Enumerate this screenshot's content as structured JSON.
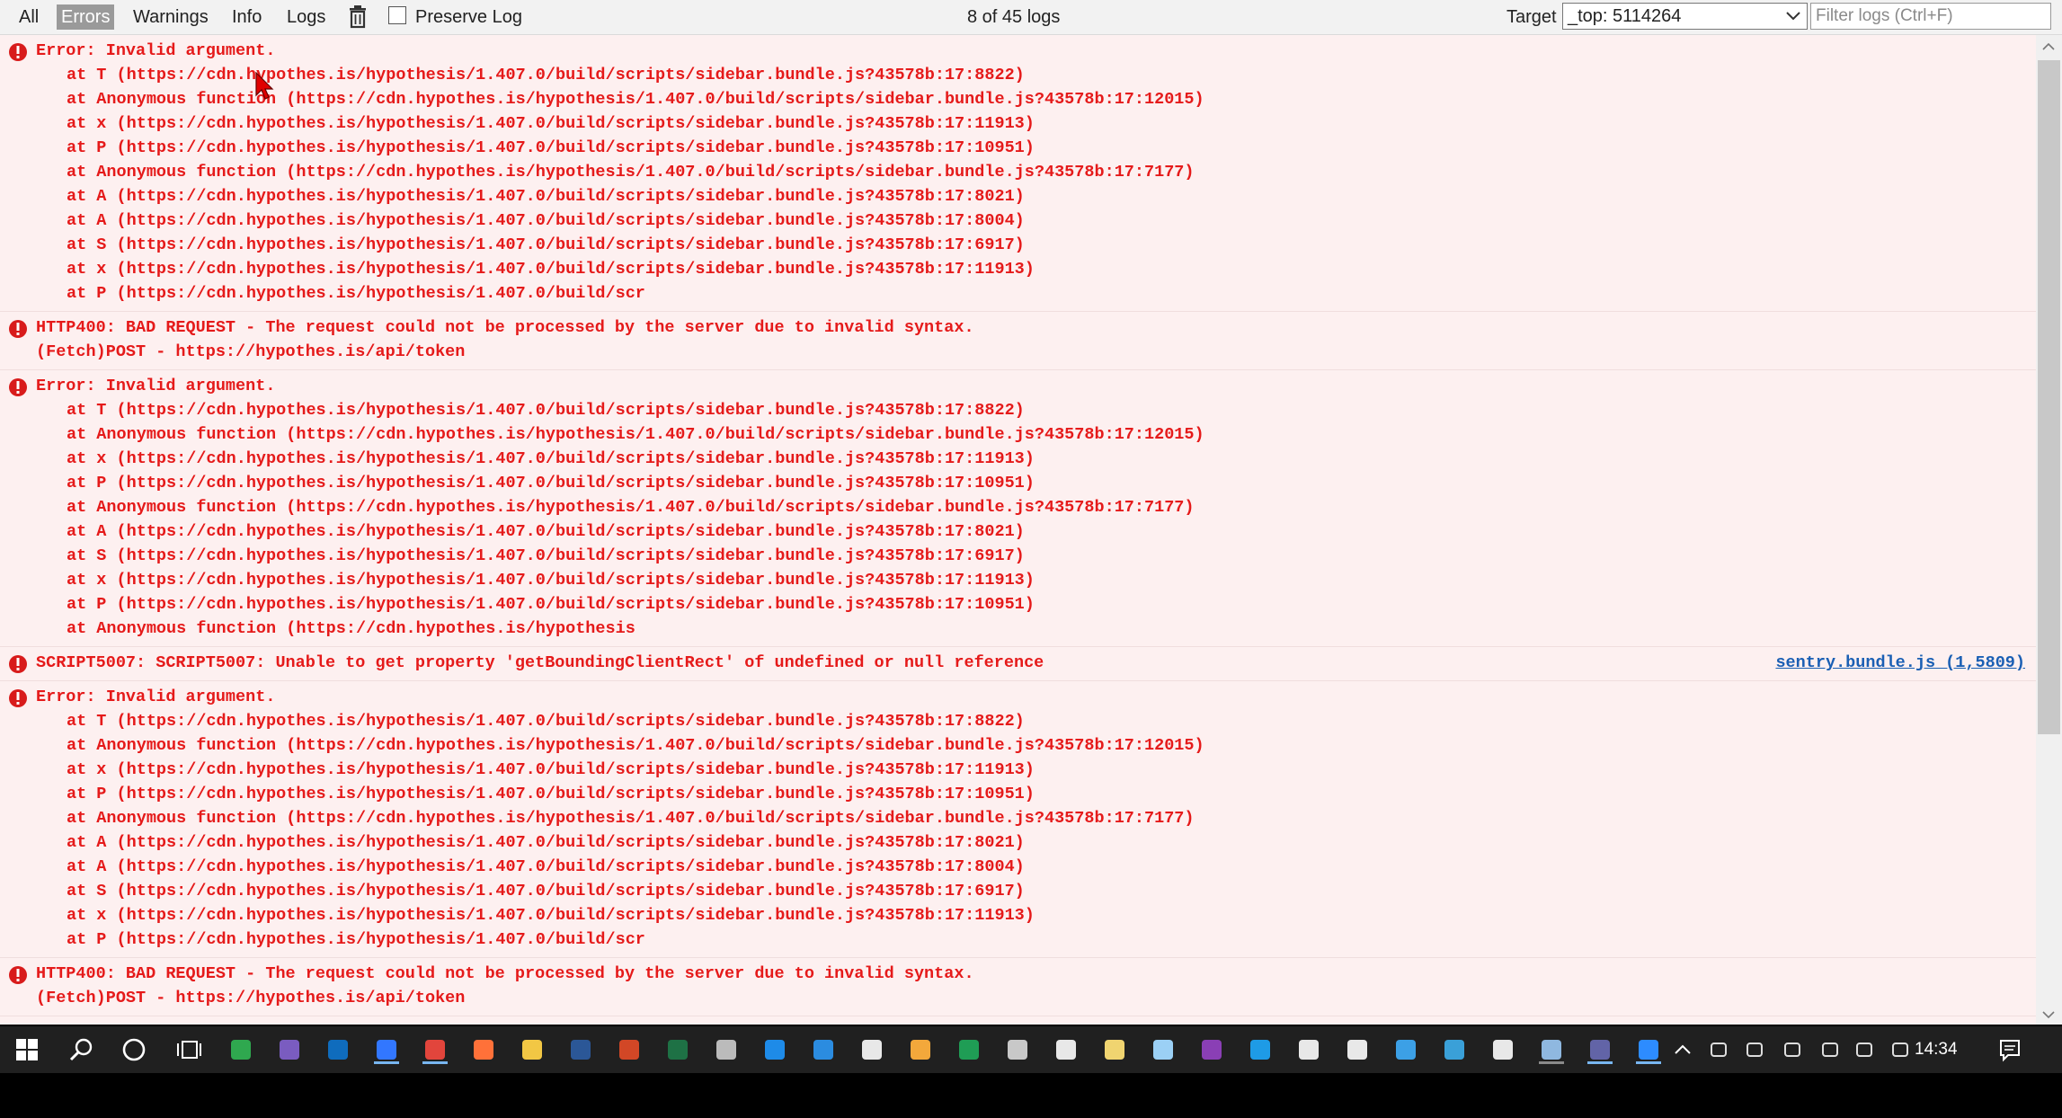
{
  "toolbar": {
    "filters": [
      {
        "label": "All",
        "active": false
      },
      {
        "label": "Errors",
        "active": true
      },
      {
        "label": "Warnings",
        "active": false
      },
      {
        "label": "Info",
        "active": false
      },
      {
        "label": "Logs",
        "active": false
      }
    ],
    "clear_icon": "trash-icon",
    "preserve_log_label": "Preserve Log",
    "preserve_log_checked": false,
    "log_count": "8 of 45 logs",
    "target_label": "Target",
    "target_value": "_top: 5114264",
    "filter_placeholder": "Filter logs (Ctrl+F)",
    "filter_value": ""
  },
  "colors": {
    "error_text": "#e51a1a",
    "error_bg": "#fdf0f0",
    "link": "#1a5fb4",
    "active_filter": "#9a9a9a"
  },
  "logs": [
    {
      "message": "Error: Invalid argument.",
      "frames": [
        "at T (https://cdn.hypothes.is/hypothesis/1.407.0/build/scripts/sidebar.bundle.js?43578b:17:8822)",
        "at Anonymous function (https://cdn.hypothes.is/hypothesis/1.407.0/build/scripts/sidebar.bundle.js?43578b:17:12015)",
        "at x (https://cdn.hypothes.is/hypothesis/1.407.0/build/scripts/sidebar.bundle.js?43578b:17:11913)",
        "at P (https://cdn.hypothes.is/hypothesis/1.407.0/build/scripts/sidebar.bundle.js?43578b:17:10951)",
        "at Anonymous function (https://cdn.hypothes.is/hypothesis/1.407.0/build/scripts/sidebar.bundle.js?43578b:17:7177)",
        "at A (https://cdn.hypothes.is/hypothesis/1.407.0/build/scripts/sidebar.bundle.js?43578b:17:8021)",
        "at A (https://cdn.hypothes.is/hypothesis/1.407.0/build/scripts/sidebar.bundle.js?43578b:17:8004)",
        "at S (https://cdn.hypothes.is/hypothesis/1.407.0/build/scripts/sidebar.bundle.js?43578b:17:6917)",
        "at x (https://cdn.hypothes.is/hypothesis/1.407.0/build/scripts/sidebar.bundle.js?43578b:17:11913)",
        "at P (https://cdn.hypothes.is/hypothesis/1.407.0/build/scr"
      ],
      "source": ""
    },
    {
      "message": "HTTP400: BAD REQUEST - The request could not be processed by the server due to invalid syntax.",
      "frames": [],
      "detail": "(Fetch)POST - https://hypothes.is/api/token",
      "source": ""
    },
    {
      "message": "Error: Invalid argument.",
      "frames": [
        "at T (https://cdn.hypothes.is/hypothesis/1.407.0/build/scripts/sidebar.bundle.js?43578b:17:8822)",
        "at Anonymous function (https://cdn.hypothes.is/hypothesis/1.407.0/build/scripts/sidebar.bundle.js?43578b:17:12015)",
        "at x (https://cdn.hypothes.is/hypothesis/1.407.0/build/scripts/sidebar.bundle.js?43578b:17:11913)",
        "at P (https://cdn.hypothes.is/hypothesis/1.407.0/build/scripts/sidebar.bundle.js?43578b:17:10951)",
        "at Anonymous function (https://cdn.hypothes.is/hypothesis/1.407.0/build/scripts/sidebar.bundle.js?43578b:17:7177)",
        "at A (https://cdn.hypothes.is/hypothesis/1.407.0/build/scripts/sidebar.bundle.js?43578b:17:8021)",
        "at S (https://cdn.hypothes.is/hypothesis/1.407.0/build/scripts/sidebar.bundle.js?43578b:17:6917)",
        "at x (https://cdn.hypothes.is/hypothesis/1.407.0/build/scripts/sidebar.bundle.js?43578b:17:11913)",
        "at P (https://cdn.hypothes.is/hypothesis/1.407.0/build/scripts/sidebar.bundle.js?43578b:17:10951)",
        "at Anonymous function (https://cdn.hypothes.is/hypothesis"
      ],
      "source": ""
    },
    {
      "message": "SCRIPT5007: SCRIPT5007: Unable to get property 'getBoundingClientRect' of undefined or null reference",
      "frames": [],
      "source": "sentry.bundle.js (1,5809)"
    },
    {
      "message": "Error: Invalid argument.",
      "frames": [
        "at T (https://cdn.hypothes.is/hypothesis/1.407.0/build/scripts/sidebar.bundle.js?43578b:17:8822)",
        "at Anonymous function (https://cdn.hypothes.is/hypothesis/1.407.0/build/scripts/sidebar.bundle.js?43578b:17:12015)",
        "at x (https://cdn.hypothes.is/hypothesis/1.407.0/build/scripts/sidebar.bundle.js?43578b:17:11913)",
        "at P (https://cdn.hypothes.is/hypothesis/1.407.0/build/scripts/sidebar.bundle.js?43578b:17:10951)",
        "at Anonymous function (https://cdn.hypothes.is/hypothesis/1.407.0/build/scripts/sidebar.bundle.js?43578b:17:7177)",
        "at A (https://cdn.hypothes.is/hypothesis/1.407.0/build/scripts/sidebar.bundle.js?43578b:17:8021)",
        "at A (https://cdn.hypothes.is/hypothesis/1.407.0/build/scripts/sidebar.bundle.js?43578b:17:8004)",
        "at S (https://cdn.hypothes.is/hypothesis/1.407.0/build/scripts/sidebar.bundle.js?43578b:17:6917)",
        "at x (https://cdn.hypothes.is/hypothesis/1.407.0/build/scripts/sidebar.bundle.js?43578b:17:11913)",
        "at P (https://cdn.hypothes.is/hypothesis/1.407.0/build/scr"
      ],
      "source": ""
    },
    {
      "message": "HTTP400: BAD REQUEST - The request could not be processed by the server due to invalid syntax.",
      "frames": [],
      "detail": "(Fetch)POST - https://hypothes.is/api/token",
      "source": ""
    }
  ],
  "taskbar": {
    "apps": [
      {
        "name": "windows-start-icon",
        "color": "#ffffff"
      },
      {
        "name": "search-icon",
        "color": "#ffffff"
      },
      {
        "name": "cortana-icon",
        "color": "#ffffff"
      },
      {
        "name": "task-view-icon",
        "color": "#ffffff"
      },
      {
        "name": "spreadsheet-app-icon",
        "color": "#2fa84f"
      },
      {
        "name": "hashtag-app-icon",
        "color": "#7a5cc0"
      },
      {
        "name": "outlook-icon",
        "color": "#0f6cbd"
      },
      {
        "name": "edge-icon",
        "color": "#3277ff"
      },
      {
        "name": "chrome-icon",
        "color": "#e2453c"
      },
      {
        "name": "firefox-icon",
        "color": "#ff7139"
      },
      {
        "name": "file-explorer-icon",
        "color": "#f2c744"
      },
      {
        "name": "word-icon",
        "color": "#2b5797"
      },
      {
        "name": "powerpoint-icon",
        "color": "#d24726"
      },
      {
        "name": "excel-icon",
        "color": "#1e7145"
      },
      {
        "name": "gamepad-icon",
        "color": "#bbbbbb"
      },
      {
        "name": "calendar-icon",
        "color": "#1e8be8"
      },
      {
        "name": "mail-icon",
        "color": "#2b8ce0"
      },
      {
        "name": "store-icon",
        "color": "#e8e8e8"
      },
      {
        "name": "publisher-icon",
        "color": "#f3a83b"
      },
      {
        "name": "excel-alt-icon",
        "color": "#1f9d55"
      },
      {
        "name": "puzzle-app-icon",
        "color": "#c8c8c8"
      },
      {
        "name": "calculator-icon",
        "color": "#e8e8e8"
      },
      {
        "name": "notes-app-icon",
        "color": "#f0d470"
      },
      {
        "name": "document-app-icon",
        "color": "#9bd0f5"
      },
      {
        "name": "onenote-icon",
        "color": "#8a3fb5"
      },
      {
        "name": "skype-icon",
        "color": "#1e9be6"
      },
      {
        "name": "monitor-app-icon",
        "color": "#e8e8e8"
      },
      {
        "name": "media-app-icon",
        "color": "#e8e8e8"
      },
      {
        "name": "speedometer-icon",
        "color": "#3ca0e6"
      },
      {
        "name": "network-app-icon",
        "color": "#3aa0d8"
      },
      {
        "name": "red-circle-app-icon",
        "color": "#e8e8e8"
      },
      {
        "name": "cloud-app-icon",
        "color": "#8fb8e0"
      },
      {
        "name": "teams-icon",
        "color": "#6264a7"
      },
      {
        "name": "zoom-icon",
        "color": "#2d8cff"
      }
    ],
    "tray": [
      {
        "name": "chevron-up-icon"
      },
      {
        "name": "teams-tray-icon"
      },
      {
        "name": "battery-icon"
      },
      {
        "name": "dropbox-icon"
      },
      {
        "name": "wifi-icon"
      },
      {
        "name": "volume-icon"
      },
      {
        "name": "onedrive-icon"
      }
    ],
    "clock": "14:34",
    "notification_icon": "notification-icon"
  }
}
